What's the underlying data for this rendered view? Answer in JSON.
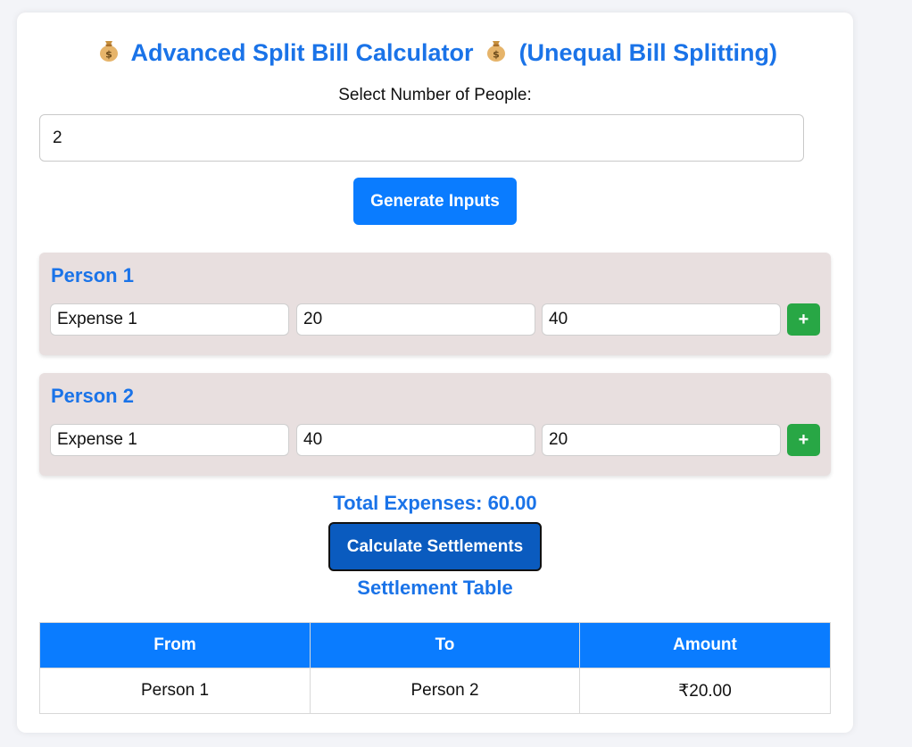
{
  "header": {
    "title_main": "Advanced Split Bill Calculator",
    "title_sub": "(Unequal Bill Splitting)",
    "icon": "money-bag-icon"
  },
  "people_select": {
    "label": "Select Number of People:",
    "value": "2"
  },
  "generate_button": {
    "label": "Generate Inputs"
  },
  "persons": [
    {
      "name": "Person 1",
      "expense": {
        "name": "Expense 1",
        "amount": "20",
        "share": "40"
      },
      "add_label": "+"
    },
    {
      "name": "Person 2",
      "expense": {
        "name": "Expense 1",
        "amount": "40",
        "share": "20"
      },
      "add_label": "+"
    }
  ],
  "total": {
    "text": "Total Expenses: 60.00"
  },
  "calculate_button": {
    "label": "Calculate Settlements"
  },
  "settlement": {
    "title": "Settlement Table",
    "headers": [
      "From",
      "To",
      "Amount"
    ],
    "rows": [
      [
        "Person 1",
        "Person 2",
        "₹20.00"
      ]
    ]
  },
  "colors": {
    "accent": "#1a73e8",
    "primary_button": "#0a7cff",
    "calc_button": "#0a5bbf",
    "add_button": "#28a745",
    "person_box": "#e8dfdf"
  }
}
